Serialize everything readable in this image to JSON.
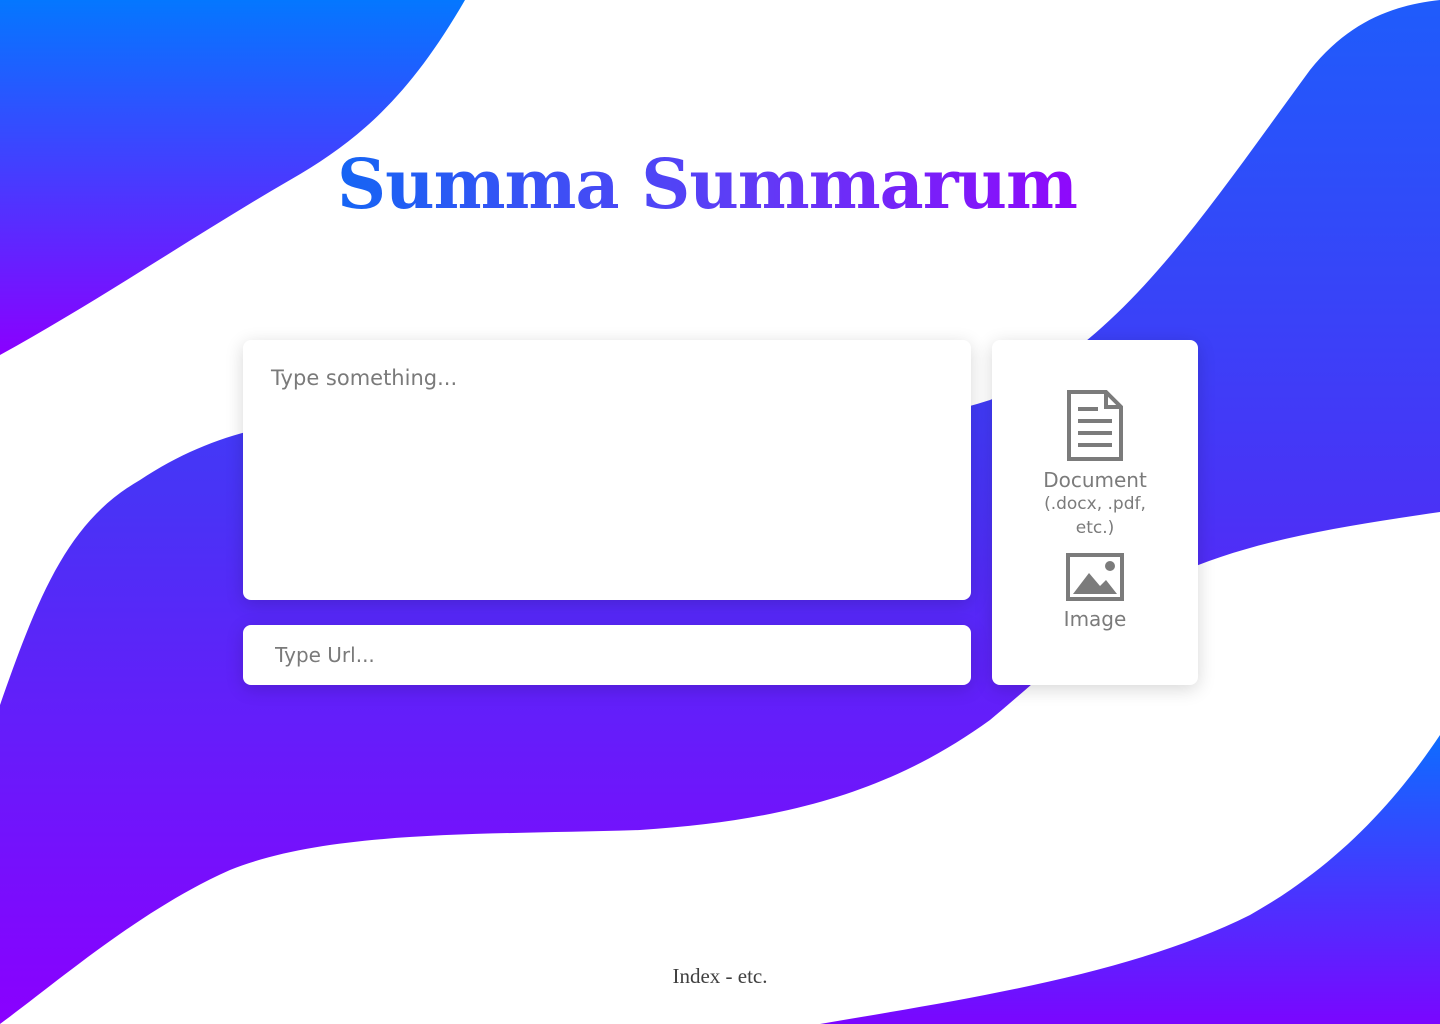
{
  "title": "Summa Summarum",
  "text_input": {
    "placeholder": "Type something..."
  },
  "url_input": {
    "placeholder": "Type Url..."
  },
  "upload": {
    "document": {
      "icon": "document-icon",
      "label": "Document",
      "formats": "(.docx, .pdf, etc.)"
    },
    "image": {
      "icon": "image-icon",
      "label": "Image"
    }
  },
  "footer": "Index - etc.",
  "colors": {
    "gradient_blue": "#0077ff",
    "gradient_purple": "#8a00ff",
    "icon_gray": "#7b7b7b",
    "card_bg": "#ffffff"
  }
}
